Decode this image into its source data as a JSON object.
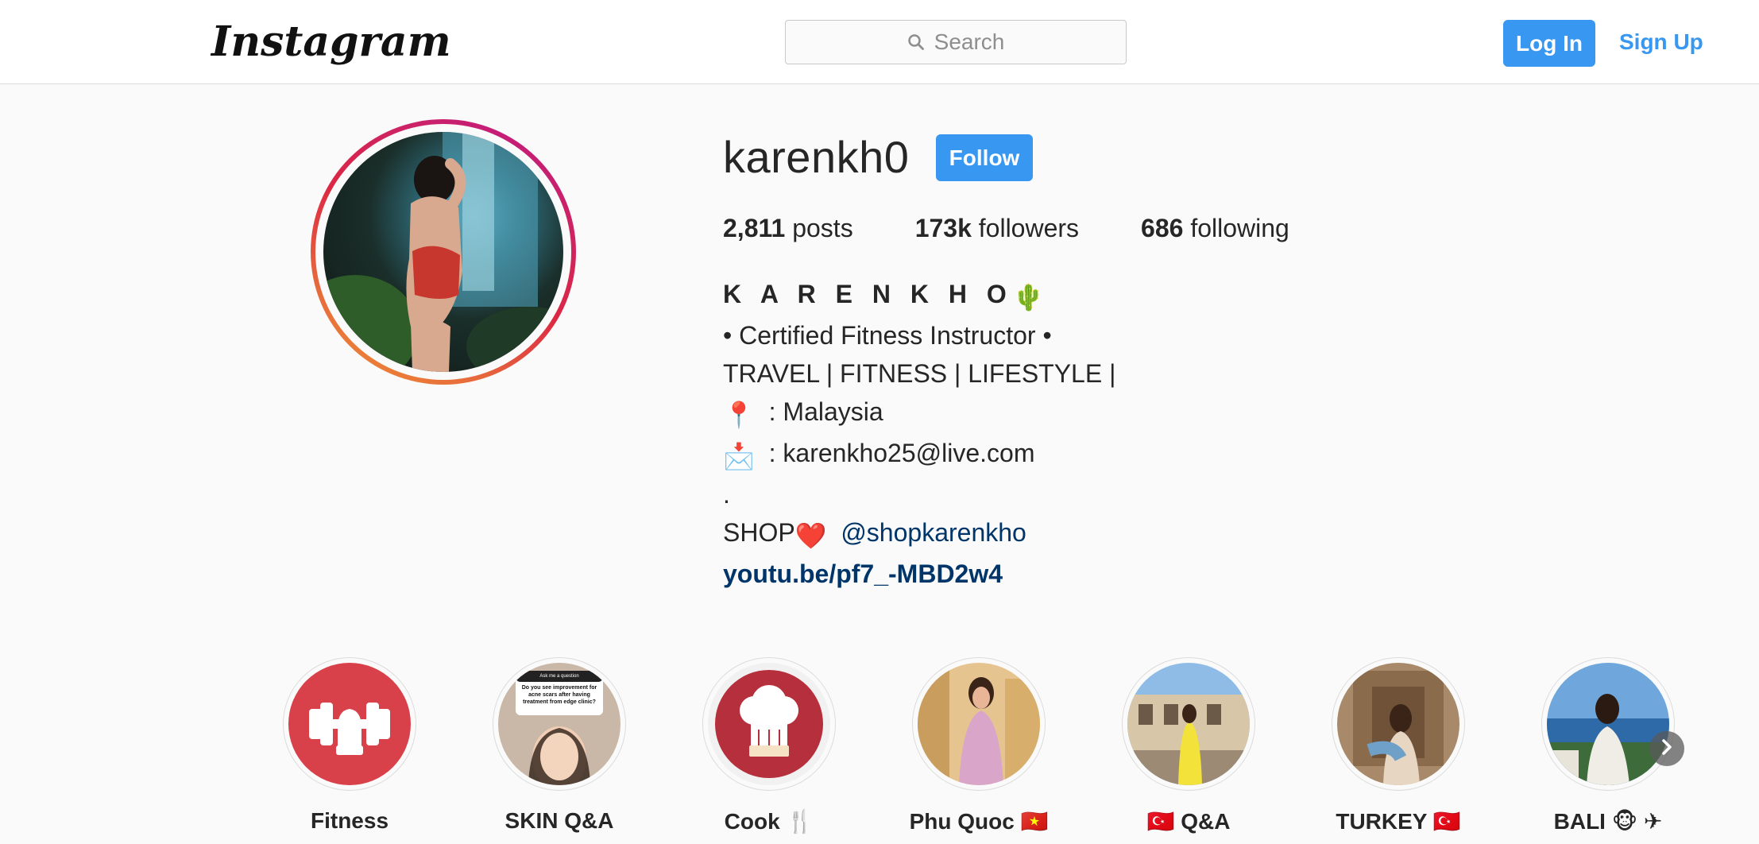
{
  "header": {
    "logo_text": "Instagram",
    "search_placeholder": "Search",
    "login_label": "Log In",
    "signup_label": "Sign Up"
  },
  "profile": {
    "username": "karenkh0",
    "follow_label": "Follow",
    "stats": [
      {
        "value": "2,811",
        "label": "posts"
      },
      {
        "value": "173k",
        "label": "followers"
      },
      {
        "value": "686",
        "label": "following"
      }
    ],
    "full_name": "K A R E N K H O",
    "full_name_emoji": "🌵",
    "bio_lines": [
      "• Certified Fitness Instructor •",
      "TRAVEL | FITNESS | LIFESTYLE |",
      ": Malaysia",
      ": karenkho25@live.com",
      "."
    ],
    "bio_icons": {
      "location": "📍",
      "mail": "📩"
    },
    "shop_text": "SHOP",
    "shop_emoji": "❤️",
    "shop_mention": "@shopkarenkho",
    "website": "youtu.be/pf7_-MBD2w4"
  },
  "highlights": [
    {
      "label": "Fitness",
      "icon": "dumbbell-icon"
    },
    {
      "label": "SKIN Q&A",
      "icon": "photo",
      "note_title": "Ask me a question",
      "note_text": "Do you see improvement for acne scars after having treatment from edge clinic?"
    },
    {
      "label": "Cook 🍴",
      "icon": "chef-hat-icon"
    },
    {
      "label": "Phu Quoc 🇻🇳",
      "icon": "photo"
    },
    {
      "label": "🇹🇷  Q&A",
      "icon": "photo"
    },
    {
      "label": "TURKEY 🇹🇷",
      "icon": "photo"
    },
    {
      "label": "BALI 🐵 ✈",
      "icon": "photo"
    }
  ],
  "colors": {
    "accent": "#3897f0",
    "link": "#003569",
    "text": "#262626",
    "highlight_red": "#d9414a"
  }
}
